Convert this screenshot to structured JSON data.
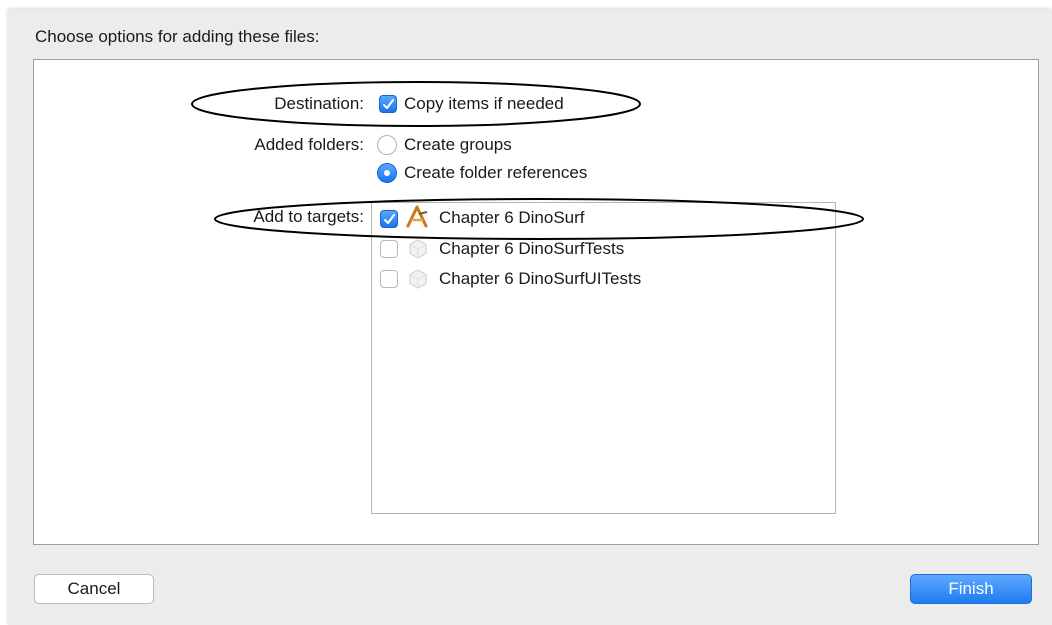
{
  "dialog": {
    "heading": "Choose options for adding these files:"
  },
  "destination": {
    "label": "Destination:",
    "option_label": "Copy items if needed",
    "checked": true
  },
  "added_folders": {
    "label": "Added folders:",
    "options": [
      {
        "label": "Create groups",
        "selected": false
      },
      {
        "label": "Create folder references",
        "selected": true
      }
    ]
  },
  "targets": {
    "label": "Add to targets:",
    "items": [
      {
        "label": "Chapter 6 DinoSurf",
        "checked": true,
        "icon": "app-target-icon"
      },
      {
        "label": "Chapter 6 DinoSurfTests",
        "checked": false,
        "icon": "test-target-icon"
      },
      {
        "label": "Chapter 6 DinoSurfUITests",
        "checked": false,
        "icon": "test-target-icon"
      }
    ]
  },
  "buttons": {
    "cancel": "Cancel",
    "finish": "Finish"
  },
  "colors": {
    "accent": "#1f7bf2",
    "panel": "#ffffff",
    "sheet": "#ececec"
  }
}
